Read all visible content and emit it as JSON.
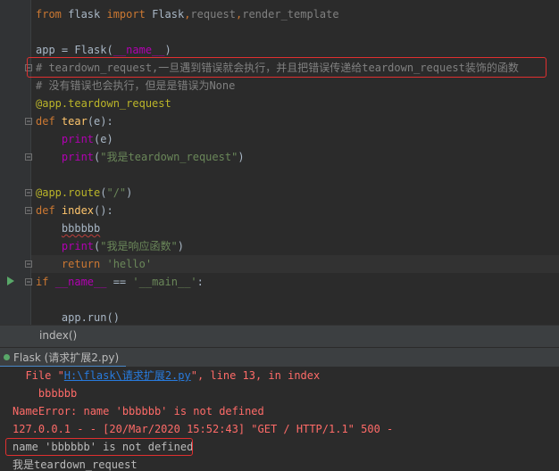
{
  "editor": {
    "lines": [
      {
        "tokens": [
          {
            "t": "from ",
            "c": "kw"
          },
          {
            "t": "flask ",
            "c": ""
          },
          {
            "t": "import ",
            "c": "kw"
          },
          {
            "t": "Flask",
            "c": ""
          },
          {
            "t": ",",
            "c": "kw"
          },
          {
            "t": "request",
            "c": "cm"
          },
          {
            "t": ",",
            "c": "kw"
          },
          {
            "t": "render_template",
            "c": "cm"
          }
        ]
      },
      {
        "tokens": []
      },
      {
        "tokens": [
          {
            "t": "app = Flask(",
            "c": ""
          },
          {
            "t": "__name__",
            "c": "dunder"
          },
          {
            "t": ")",
            "c": ""
          }
        ]
      },
      {
        "tokens": [
          {
            "t": "# teardown_request,一旦遇到错误就会执行，并且把错误传递给teardown_request装饰的函数",
            "c": "cm"
          }
        ]
      },
      {
        "tokens": [
          {
            "t": "# 没有错误也会执行，但是是错误为None",
            "c": "cm"
          }
        ]
      },
      {
        "tokens": [
          {
            "t": "@app.teardown_request",
            "c": "dec"
          }
        ]
      },
      {
        "tokens": [
          {
            "t": "def ",
            "c": "kw"
          },
          {
            "t": "tear",
            "c": "fn"
          },
          {
            "t": "(e):",
            "c": ""
          }
        ]
      },
      {
        "tokens": [
          {
            "t": "    print",
            "c": "dunder"
          },
          {
            "t": "(e)",
            "c": ""
          }
        ]
      },
      {
        "tokens": [
          {
            "t": "    print",
            "c": "dunder"
          },
          {
            "t": "(",
            "c": ""
          },
          {
            "t": "\"我是teardown_request\"",
            "c": "str"
          },
          {
            "t": ")",
            "c": ""
          }
        ]
      },
      {
        "tokens": []
      },
      {
        "tokens": [
          {
            "t": "@app.route",
            "c": "dec"
          },
          {
            "t": "(",
            "c": ""
          },
          {
            "t": "\"/\"",
            "c": "str"
          },
          {
            "t": ")",
            "c": ""
          }
        ]
      },
      {
        "tokens": [
          {
            "t": "def ",
            "c": "kw"
          },
          {
            "t": "index",
            "c": "fn"
          },
          {
            "t": "():",
            "c": ""
          }
        ]
      },
      {
        "tokens": [
          {
            "t": "    ",
            "c": ""
          },
          {
            "t": "bbbbbb",
            "c": "err"
          }
        ]
      },
      {
        "tokens": [
          {
            "t": "    print",
            "c": "dunder"
          },
          {
            "t": "(",
            "c": ""
          },
          {
            "t": "\"我是响应函数\"",
            "c": "str"
          },
          {
            "t": ")",
            "c": ""
          }
        ]
      },
      {
        "tokens": [
          {
            "t": "    return ",
            "c": "kw"
          },
          {
            "t": "'hello'",
            "c": "str"
          }
        ]
      },
      {
        "tokens": [
          {
            "t": "if ",
            "c": "kw"
          },
          {
            "t": "__name__",
            "c": "dunder"
          },
          {
            "t": " == ",
            "c": ""
          },
          {
            "t": "'__main__'",
            "c": "str"
          },
          {
            "t": ":",
            "c": ""
          }
        ]
      },
      {
        "tokens": []
      },
      {
        "tokens": [
          {
            "t": "    app.run()",
            "c": ""
          }
        ]
      }
    ]
  },
  "breadcrumb": "index()",
  "run_tab": "Flask (请求扩展2.py)",
  "console": {
    "file_prefix": "  File \"",
    "file_link": "H:\\flask\\请求扩展2.py",
    "file_suffix": "\", line 13, in index",
    "code_line": "    bbbbbb",
    "name_error": "NameError: name 'bbbbbb' is not defined",
    "access_log": "127.0.0.1 - - [20/Mar/2020 15:52:43] \"GET / HTTP/1.1\" 500 -",
    "printed_error": "name 'bbbbbb' is not defined",
    "printed_msg": "我是teardown_request"
  },
  "colors": {
    "background": "#2b2b2b",
    "error_box": "#e03030",
    "keyword": "#cc7832",
    "string": "#6a8759",
    "comment": "#808080"
  }
}
